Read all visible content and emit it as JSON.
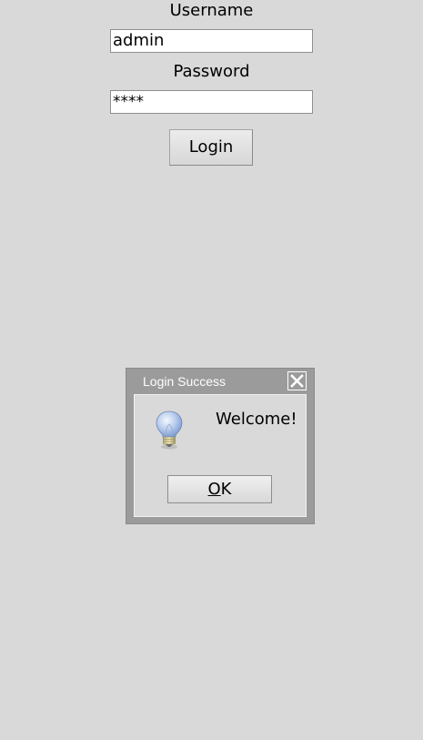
{
  "form": {
    "username_label": "Username",
    "username_value": "admin",
    "password_label": "Password",
    "password_value": "****",
    "login_label": "Login"
  },
  "dialog": {
    "title": "Login Success",
    "message": "Welcome!",
    "icon": "lightbulb-icon",
    "close_icon": "close-icon",
    "ok_mnemonic": "O",
    "ok_rest": "K"
  },
  "colors": {
    "background": "#d9d9d9",
    "dialog_frame": "#9b9b9b",
    "title_text": "#ffffff"
  }
}
